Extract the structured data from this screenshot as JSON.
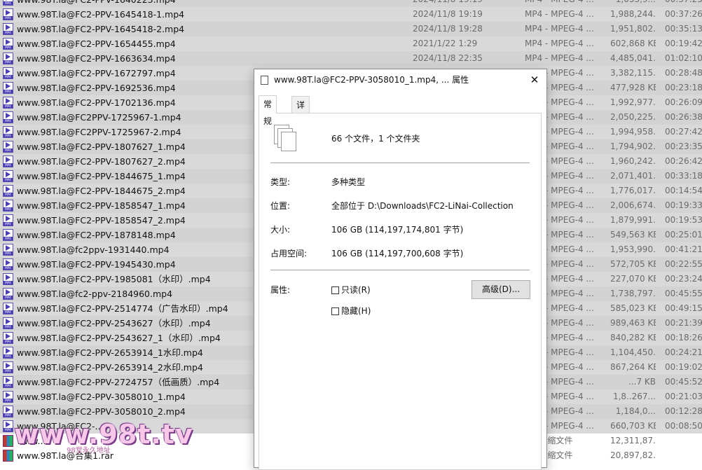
{
  "files": [
    {
      "name": "www.98T.la@FC2-PPV-1640223.mp4",
      "date": "2024/11/8 19:19",
      "type": "MP4 - MPEG-4 ...",
      "size": "1,053,9...",
      "duration": "00:37:25",
      "icon": "mp4-icon",
      "partial": true
    },
    {
      "name": "www.98T.la@FC2-PPV-1645418-1.mp4",
      "date": "2024/11/8 19:19",
      "type": "MP4 - MPEG-4 ...",
      "size": "1,988,244...",
      "duration": "00:37:26",
      "icon": "mp4-icon"
    },
    {
      "name": "www.98T.la@FC2-PPV-1645418-2.mp4",
      "date": "2024/11/8 19:28",
      "type": "MP4 - MPEG-4 ...",
      "size": "1,951,802...",
      "duration": "00:35:13",
      "icon": "mp4-icon"
    },
    {
      "name": "www.98T.la@FC2-PPV-1654455.mp4",
      "date": "2021/1/22 1:29",
      "type": "MP4 - MPEG-4 ...",
      "size": "602,868 KB",
      "duration": "00:19:42",
      "icon": "mp4-icon"
    },
    {
      "name": "www.98T.la@FC2-PPV-1663634.mp4",
      "date": "2024/11/8 22:35",
      "type": "MP4 - MPEG-4 ...",
      "size": "4,485,041...",
      "duration": "01:02:10",
      "icon": "mp4-icon"
    },
    {
      "name": "www.98T.la@FC2-PPV-1672797.mp4",
      "date": "",
      "type": "MP4 - MPEG-4 ...",
      "size": "3,382,115...",
      "duration": "00:28:48",
      "icon": "mp4-icon"
    },
    {
      "name": "www.98T.la@FC2-PPV-1692536.mp4",
      "date": "",
      "type": "MP4 - MPEG-4 ...",
      "size": "477,928 KB",
      "duration": "00:23:18",
      "icon": "mp4-icon"
    },
    {
      "name": "www.98T.la@FC2-PPV-1702136.mp4",
      "date": "",
      "type": "MP4 - MPEG-4 ...",
      "size": "1,992,977...",
      "duration": "00:26:09",
      "icon": "mp4-icon"
    },
    {
      "name": "www.98T.la@FC2PPV-1725967-1.mp4",
      "date": "",
      "type": "MP4 - MPEG-4 ...",
      "size": "2,050,225...",
      "duration": "00:26:38",
      "icon": "mp4-icon"
    },
    {
      "name": "www.98T.la@FC2PPV-1725967-2.mp4",
      "date": "",
      "type": "MP4 - MPEG-4 ...",
      "size": "1,994,958...",
      "duration": "00:27:42",
      "icon": "mp4-icon"
    },
    {
      "name": "www.98T.la@FC2-PPV-1807627_1.mp4",
      "date": "",
      "type": "MP4 - MPEG-4 ...",
      "size": "1,794,902...",
      "duration": "00:23:35",
      "icon": "mp4-icon"
    },
    {
      "name": "www.98T.la@FC2-PPV-1807627_2.mp4",
      "date": "",
      "type": "MP4 - MPEG-4 ...",
      "size": "1,960,242...",
      "duration": "00:26:42",
      "icon": "mp4-icon"
    },
    {
      "name": "www.98T.la@FC2-PPV-1844675_1.mp4",
      "date": "",
      "type": "MP4 - MPEG-4 ...",
      "size": "2,071,401...",
      "duration": "00:33:18",
      "icon": "mp4-icon"
    },
    {
      "name": "www.98T.la@FC2-PPV-1844675_2.mp4",
      "date": "",
      "type": "MP4 - MPEG-4 ...",
      "size": "1,776,017...",
      "duration": "00:14:54",
      "icon": "mp4-icon"
    },
    {
      "name": "www.98T.la@FC2-PPV-1858547_1.mp4",
      "date": "",
      "type": "MP4 - MPEG-4 ...",
      "size": "2,006,674...",
      "duration": "00:19:33",
      "icon": "mp4-icon"
    },
    {
      "name": "www.98T.la@FC2-PPV-1858547_2.mp4",
      "date": "",
      "type": "MP4 - MPEG-4 ...",
      "size": "1,879,991...",
      "duration": "00:19:53",
      "icon": "mp4-icon"
    },
    {
      "name": "www.98T.la@FC2-PPV-1878148.mp4",
      "date": "",
      "type": "MP4 - MPEG-4 ...",
      "size": "549,563 KB",
      "duration": "00:25:01",
      "icon": "mp4-icon"
    },
    {
      "name": "www.98T.la@fc2ppv-1931440.mp4",
      "date": "",
      "type": "MP4 - MPEG-4 ...",
      "size": "1,953,990...",
      "duration": "00:41:21",
      "icon": "mp4-icon"
    },
    {
      "name": "www.98T.la@FC2-PPV-1945430.mp4",
      "date": "",
      "type": "MP4 - MPEG-4 ...",
      "size": "572,705 KB",
      "duration": "00:22:55",
      "icon": "mp4-icon"
    },
    {
      "name": "www.98T.la@FC2-PPV-1985081（水印）.mp4",
      "date": "",
      "type": "MP4 - MPEG-4 ...",
      "size": "227,070 KB",
      "duration": "00:23:24",
      "icon": "mp4-icon"
    },
    {
      "name": "www.98T.la@fc2-ppv-2184960.mp4",
      "date": "",
      "type": "MP4 - MPEG-4 ...",
      "size": "1,738,797...",
      "duration": "00:45:55",
      "icon": "mp4-icon"
    },
    {
      "name": "www.98T.la@FC2-PPV-2514774（广告水印）.mp4",
      "date": "",
      "type": "MP4 - MPEG-4 ...",
      "size": "585,023 KB",
      "duration": "00:49:15",
      "icon": "mp4-icon"
    },
    {
      "name": "www.98T.la@FC2-PPV-2543627（水印）.mp4",
      "date": "",
      "type": "MP4 - MPEG-4 ...",
      "size": "989,463 KB",
      "duration": "00:21:39",
      "icon": "mp4-icon"
    },
    {
      "name": "www.98T.la@FC2-PPV-2543627_1（水印）.mp4",
      "date": "",
      "type": "MP4 - MPEG-4 ...",
      "size": "840,282 KB",
      "duration": "00:18:26",
      "icon": "mp4-icon"
    },
    {
      "name": "www.98T.la@FC2-PPV-2653914_1水印.mp4",
      "date": "",
      "type": "MP4 - MPEG-4 ...",
      "size": "1,104,450...",
      "duration": "00:24:21",
      "icon": "mp4-icon"
    },
    {
      "name": "www.98T.la@FC2-PPV-2653914_2水印.mp4",
      "date": "",
      "type": "MP4 - MPEG-4 ...",
      "size": "867,264 KB",
      "duration": "00:19:02",
      "icon": "mp4-icon"
    },
    {
      "name": "www.98T.la@FC2-PPV-2724757（低画质）.mp4",
      "date": "",
      "type": "MP4 - MPEG-4 ...",
      "size": "...7 KB",
      "duration": "00:45:52",
      "icon": "mp4-icon"
    },
    {
      "name": "www.98T.la@FC2-PPV-3058010_1.mp4",
      "date": "",
      "type": "MP4 - MPEG-4 ...",
      "size": "1,8..267...",
      "duration": "00:21:03",
      "icon": "mp4-icon"
    },
    {
      "name": "www.98T.la@FC2-PPV-3058010_2.mp4",
      "date": "",
      "type": "MP4 - MPEG-4 ...",
      "size": "1,184,0...",
      "duration": "00:12:28",
      "icon": "mp4-icon"
    },
    {
      "name": "www.98T.la@FC2-...",
      "date": "",
      "type": "MP4 - MPEG-4 ...",
      "size": "660,703 KB",
      "duration": "00:08:50",
      "icon": "mp4-icon"
    },
    {
      "name": "www...",
      "date": "",
      "type": "AR 压缩文件",
      "size": "12,311,87...",
      "duration": "",
      "icon": "rar-icon",
      "unselected": true
    },
    {
      "name": "www.98T.la@合集1.rar",
      "date": "",
      "type": "AR 压缩文件",
      "size": "20,897,82...",
      "duration": "",
      "icon": "rar-icon",
      "unselected": true
    }
  ],
  "dialog": {
    "title": "www.98T.la@FC2-PPV-3058010_1.mp4, ... 属性",
    "close_glyph": "✕",
    "tabs": [
      "常规",
      "详细信息"
    ],
    "summary": "66 个文件，1 个文件夹",
    "fields": [
      {
        "label": "类型:",
        "value": "多种类型"
      },
      {
        "label": "位置:",
        "value": "全部位于 D:\\Downloads\\FC2-LiNai-Collection"
      },
      {
        "label": "大小:",
        "value": "106 GB (114,197,174,801 字节)"
      },
      {
        "label": "占用空间:",
        "value": "106 GB (114,197,700,608 字节)"
      }
    ],
    "attributes_label": "属性:",
    "readonly_label": "只读(R)",
    "hidden_label": "隐藏(H)",
    "advanced_button": "高级(D)..."
  },
  "watermark": {
    "text": "www.98t.tv",
    "sub": "98堂永久地址"
  },
  "colors": {
    "selection": "#d9d9d9",
    "mp4_icon": "#4b3fb5",
    "watermark": "#f7c8e8"
  }
}
